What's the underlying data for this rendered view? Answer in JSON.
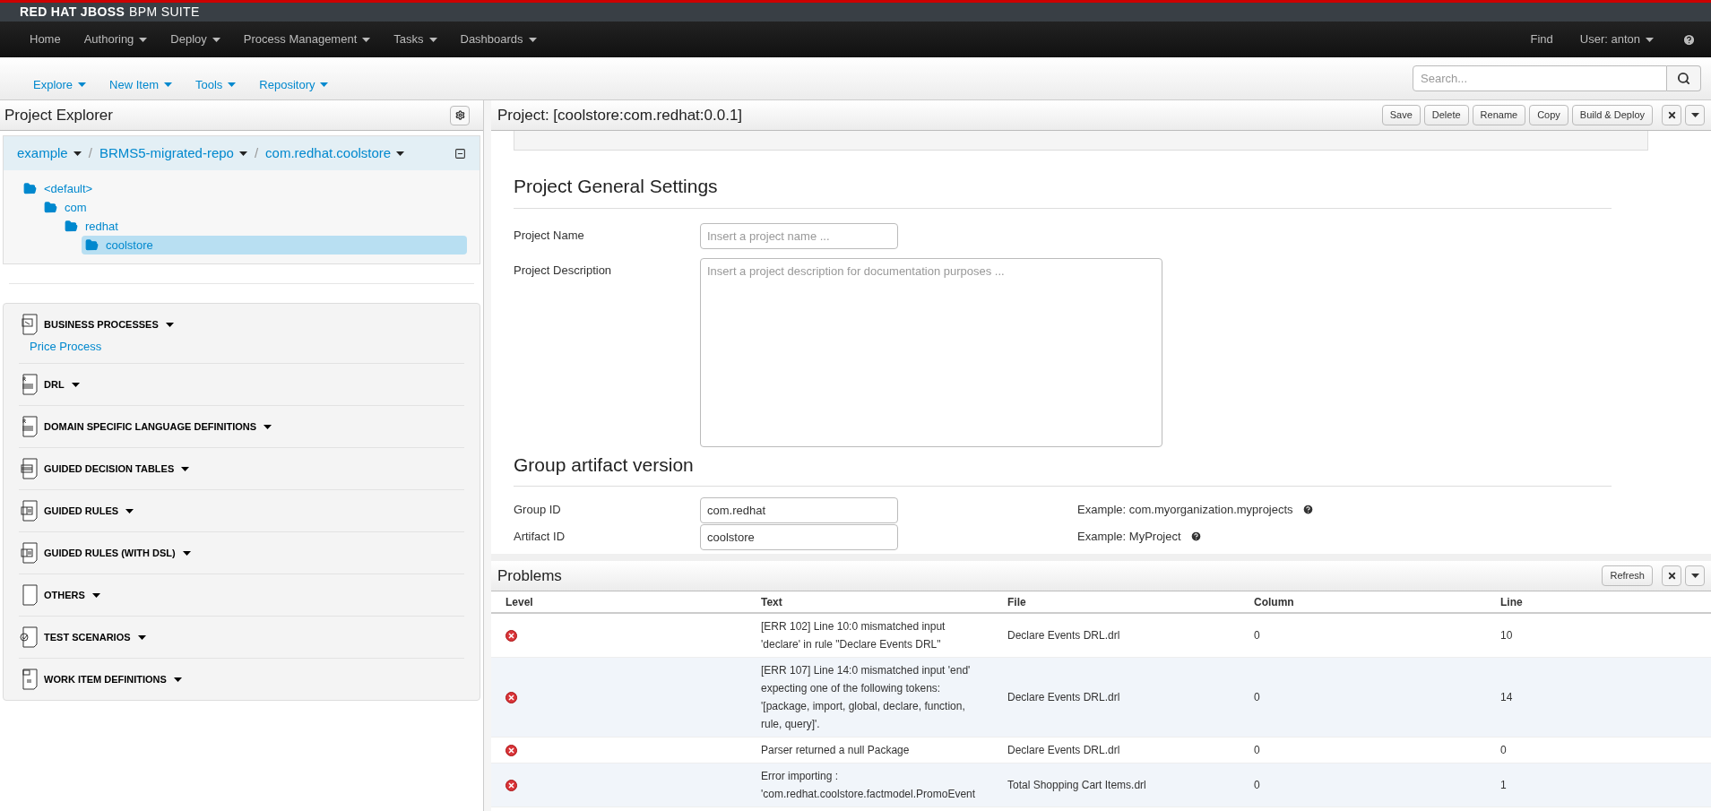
{
  "brand": {
    "name": "RED HAT JBOSS",
    "product": "BPM SUITE"
  },
  "nav": {
    "items": [
      {
        "label": "Home",
        "has_menu": false
      },
      {
        "label": "Authoring",
        "has_menu": true
      },
      {
        "label": "Deploy",
        "has_menu": true
      },
      {
        "label": "Process Management",
        "has_menu": true
      },
      {
        "label": "Tasks",
        "has_menu": true
      },
      {
        "label": "Dashboards",
        "has_menu": true
      }
    ],
    "right": [
      {
        "label": "Find",
        "has_menu": false
      },
      {
        "label": "User: anton",
        "has_menu": true
      }
    ]
  },
  "subnav": {
    "items": [
      {
        "label": "Explore"
      },
      {
        "label": "New Item"
      },
      {
        "label": "Tools"
      },
      {
        "label": "Repository"
      }
    ],
    "search": {
      "placeholder": "Search..."
    }
  },
  "explorer": {
    "title": "Project Explorer",
    "breadcrumb": [
      "example",
      "BRMS5-migrated-repo",
      "com.redhat.coolstore"
    ],
    "breadcrumb_separator": "/",
    "tree": [
      {
        "label": "<default>",
        "selected": false,
        "children": [
          {
            "label": "com",
            "selected": false,
            "children": [
              {
                "label": "redhat",
                "selected": false,
                "children": [
                  {
                    "label": "coolstore",
                    "selected": true
                  }
                ]
              }
            ]
          }
        ]
      }
    ],
    "categories": [
      {
        "label": "BUSINESS PROCESSES",
        "kind": "process",
        "items": [
          "Price Process"
        ]
      },
      {
        "label": "DRL",
        "kind": "drl"
      },
      {
        "label": "DOMAIN SPECIFIC LANGUAGE DEFINITIONS",
        "kind": "drl"
      },
      {
        "label": "GUIDED DECISION TABLES",
        "kind": "table"
      },
      {
        "label": "GUIDED RULES",
        "kind": "rule"
      },
      {
        "label": "GUIDED RULES (WITH DSL)",
        "kind": "rule"
      },
      {
        "label": "OTHERS",
        "kind": "blank"
      },
      {
        "label": "TEST SCENARIOS",
        "kind": "test"
      },
      {
        "label": "WORK ITEM DEFINITIONS",
        "kind": "workitem"
      }
    ]
  },
  "editor": {
    "title": "Project: [coolstore:com.redhat:0.0.1]",
    "actions": [
      "Save",
      "Delete",
      "Rename",
      "Copy",
      "Build & Deploy"
    ],
    "sections": [
      {
        "heading": "Project General Settings",
        "fields": [
          {
            "label": "Project Name",
            "kind": "input",
            "placeholder": "Insert a project name ..."
          },
          {
            "label": "Project Description",
            "kind": "textarea",
            "placeholder": "Insert a project description for documentation purposes ..."
          }
        ]
      },
      {
        "heading": "Group artifact version",
        "fields": [
          {
            "label": "Group ID",
            "kind": "input",
            "value": "com.redhat",
            "hint": "Example: com.myorganization.myprojects"
          },
          {
            "label": "Artifact ID",
            "kind": "input",
            "value": "coolstore",
            "hint": "Example: MyProject"
          }
        ]
      }
    ]
  },
  "problems": {
    "title": "Problems",
    "refresh": "Refresh",
    "columns": [
      "Level",
      "Text",
      "File",
      "Column",
      "Line"
    ],
    "rows": [
      {
        "kind": "error",
        "text": "[ERR 102] Line 10:0 mismatched input 'declare' in rule \"Declare Events DRL\"",
        "file": "Declare Events DRL.drl",
        "column": "0",
        "line": "10"
      },
      {
        "kind": "error",
        "text": "[ERR 107] Line 14:0 mismatched input 'end' expecting one of the following tokens: '[package, import, global, declare, function, rule, query]'.",
        "file": "Declare Events DRL.drl",
        "column": "0",
        "line": "14"
      },
      {
        "kind": "error",
        "text": "Parser returned a null Package",
        "file": "Declare Events DRL.drl",
        "column": "0",
        "line": "0"
      },
      {
        "kind": "error",
        "text": "Error importing : 'com.redhat.coolstore.factmodel.PromoEvent",
        "file": "Total Shopping Cart Items.drl",
        "column": "0",
        "line": "1"
      }
    ]
  }
}
